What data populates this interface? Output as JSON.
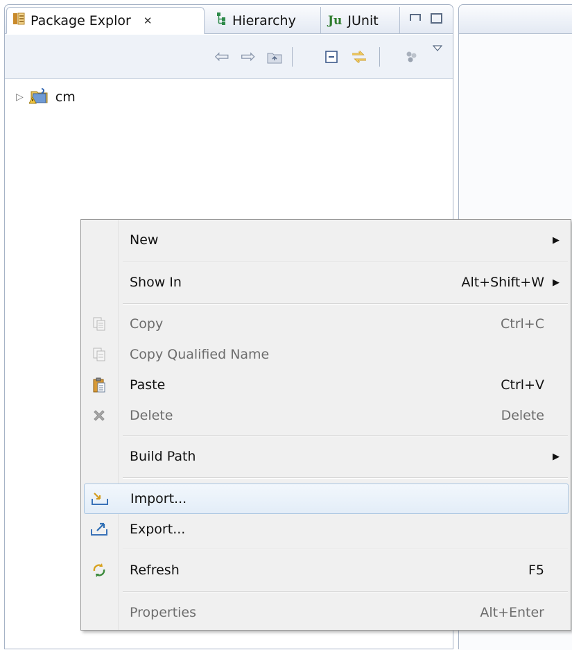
{
  "views": {
    "tabs": [
      {
        "label": "Package Explor",
        "icon": "package-explorer-icon",
        "active": true
      },
      {
        "label": "Hierarchy",
        "icon": "hierarchy-icon",
        "active": false
      },
      {
        "label": "JUnit",
        "icon": "junit-icon",
        "badge": "Ju",
        "active": false
      }
    ],
    "close_glyph": "✕"
  },
  "toolbar": {
    "icons": [
      "back-arrow-icon",
      "forward-arrow-icon",
      "up-folder-icon",
      "collapse-all-icon",
      "link-editor-icon",
      "view-menu-icon",
      "view-dropdown-icon"
    ]
  },
  "tree": {
    "project": {
      "label": "cm",
      "icon": "java-project-warning-icon",
      "expanded": false
    }
  },
  "context_menu": {
    "items": [
      {
        "label": "New",
        "shortcut": "",
        "submenu": true,
        "enabled": true
      },
      {
        "label": "Show In",
        "shortcut": "Alt+Shift+W",
        "submenu": true,
        "enabled": true
      },
      {
        "label": "Copy",
        "shortcut": "Ctrl+C",
        "submenu": false,
        "enabled": false,
        "icon": "copy-icon"
      },
      {
        "label": "Copy Qualified Name",
        "shortcut": "",
        "submenu": false,
        "enabled": false,
        "icon": "copy-qualified-name-icon"
      },
      {
        "label": "Paste",
        "shortcut": "Ctrl+V",
        "submenu": false,
        "enabled": true,
        "icon": "paste-icon"
      },
      {
        "label": "Delete",
        "shortcut": "Delete",
        "submenu": false,
        "enabled": false,
        "icon": "delete-icon"
      },
      {
        "label": "Build Path",
        "shortcut": "",
        "submenu": true,
        "enabled": true
      },
      {
        "label": "Import...",
        "shortcut": "",
        "submenu": false,
        "enabled": true,
        "highlighted": true,
        "icon": "import-icon"
      },
      {
        "label": "Export...",
        "shortcut": "",
        "submenu": false,
        "enabled": true,
        "icon": "export-icon"
      },
      {
        "label": "Refresh",
        "shortcut": "F5",
        "submenu": false,
        "enabled": true,
        "icon": "refresh-icon"
      },
      {
        "label": "Properties",
        "shortcut": "Alt+Enter",
        "submenu": false,
        "enabled": false
      }
    ]
  },
  "colors": {
    "highlight_border": "#a8c4e0",
    "panel_border": "#a6b3c6",
    "disabled_text": "#6d6d6d"
  }
}
